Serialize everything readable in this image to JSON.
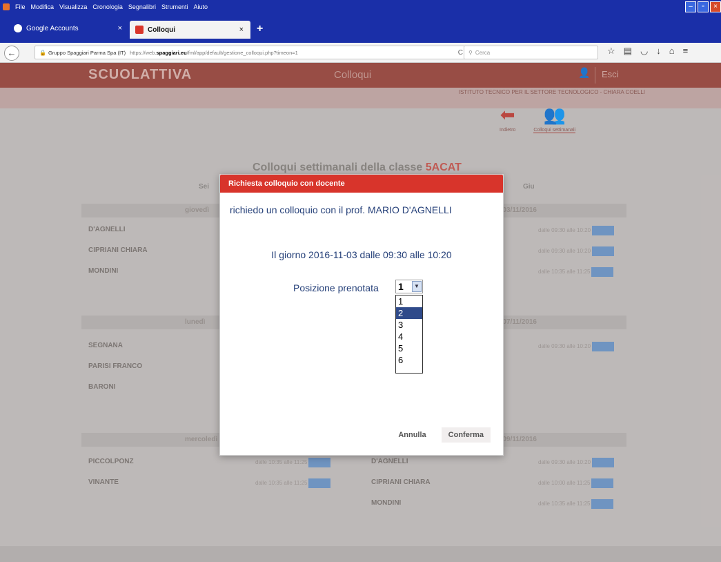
{
  "browser": {
    "menu": [
      "File",
      "Modifica",
      "Visualizza",
      "Cronologia",
      "Segnalibri",
      "Strumenti",
      "Aiuto"
    ],
    "tabs": [
      {
        "label": "Google Accounts",
        "close": "×"
      },
      {
        "label": "Colloqui",
        "close": "×"
      }
    ],
    "new_tab": "+",
    "url_site": "Gruppo Spaggiari Parma Spa (IT)",
    "url_prefix": "https://web.",
    "url_domain": "spaggiari.eu",
    "url_rest": "/fml/app/default/gestione_colloqui.php?timeon=1",
    "search_placeholder": "Cerca"
  },
  "site": {
    "brand": "SCUOLATTIVA",
    "header_title": "Colloqui",
    "user_short": "Esci",
    "institute": "ISTITUTO TECNICO PER IL SETTORE TECNOLOGICO - CHIARA COELLI",
    "nav": [
      {
        "label": "Indietro",
        "icon": "back-arrow-icon"
      },
      {
        "label": "Colloqui settimanali",
        "icon": "people-icon"
      }
    ],
    "class_title_prefix": "Colloqui settimanali della classe",
    "class_name": "5ACAT",
    "col_left": "Sei",
    "col_right": "Giu",
    "days": [
      {
        "left": "giovedì",
        "right": "03/11/2016"
      },
      {
        "left": "lunedì",
        "right": "07/11/2016"
      },
      {
        "left": "mercoledì",
        "right": "09/11/2016"
      }
    ],
    "rows_block1": [
      {
        "name": "D'AGNELLI",
        "slot": "dalle 09:30 alle 10:20"
      },
      {
        "name": "CIPRIANI CHIARA",
        "slot": "dalle 09:30 alle 10:20"
      },
      {
        "name": "MONDINI",
        "slot": "dalle 10:35 alle 11:25"
      }
    ],
    "rows_block2": [
      {
        "name": "SEGNANA",
        "slot": "dalle 09:30 alle 10:20"
      },
      {
        "name": "PARISI FRANCO",
        "slot": ""
      },
      {
        "name": "BARONI",
        "slot": ""
      }
    ],
    "rows_block3_left": [
      {
        "name": "PICCOLPONZ",
        "slot": "dalle 10:35 alle 11:25"
      },
      {
        "name": "VINANTE",
        "slot": "dalle 10:35 alle 11:25"
      }
    ],
    "rows_block3_right": [
      {
        "name": "D'AGNELLI",
        "slot": "dalle 09:30 alle 10:20"
      },
      {
        "name": "CIPRIANI CHIARA",
        "slot": "dalle 10:00 alle 11:25"
      },
      {
        "name": "MONDINI",
        "slot": "dalle 10:35 alle 11:25"
      }
    ]
  },
  "modal": {
    "title": "Richiesta colloquio con docente",
    "message": "richiedo un colloquio con il prof. MARIO D'AGNELLI",
    "date_line": "Il giorno 2016-11-03 dalle 09:30 alle 10:20",
    "position_label": "Posizione prenotata",
    "selected_value": "1",
    "options": [
      "1",
      "2",
      "3",
      "4",
      "5",
      "6"
    ],
    "highlighted_option": "2",
    "cancel": "Annulla",
    "confirm": "Conferma"
  }
}
